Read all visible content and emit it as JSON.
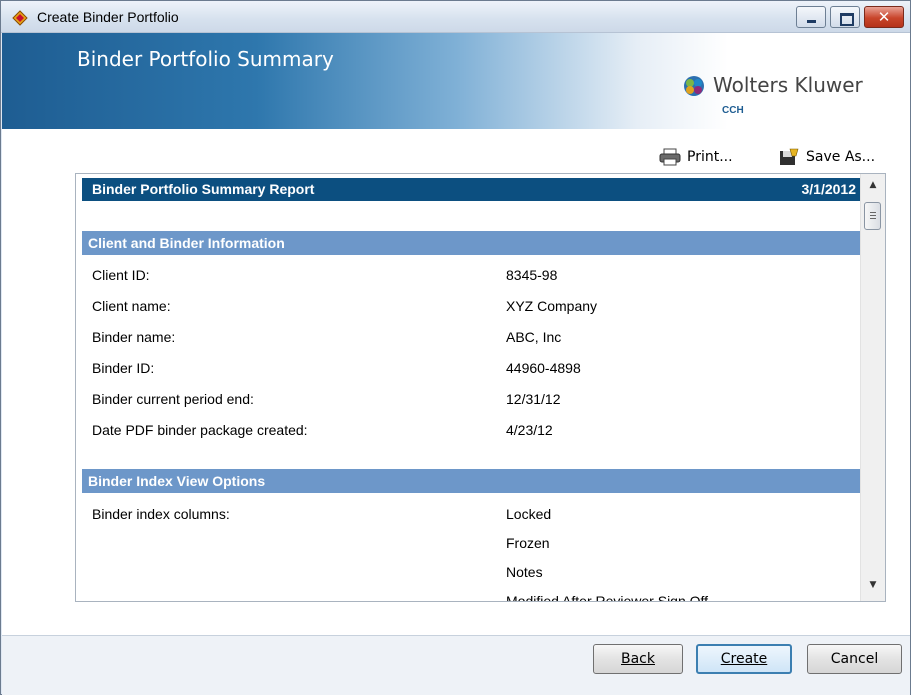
{
  "window": {
    "title": "Create Binder Portfolio"
  },
  "banner": {
    "title": "Binder Portfolio Summary",
    "logo_text": "Wolters Kluwer",
    "logo_sub": "CCH"
  },
  "toolbar": {
    "print_label": "Print...",
    "save_as_label": "Save As..."
  },
  "report": {
    "title": "Binder Portfolio  Summary Report",
    "date": "3/1/2012",
    "sections": [
      {
        "title": "Client and Binder Information",
        "rows": [
          {
            "label": "Client ID:",
            "value": "8345-98"
          },
          {
            "label": "Client name:",
            "value": "XYZ Company"
          },
          {
            "label": "Binder name:",
            "value": "ABC, Inc"
          },
          {
            "label": "Binder ID:",
            "value": "44960-4898"
          },
          {
            "label": "Binder current period end:",
            "value": "12/31/12"
          },
          {
            "label": "Date PDF binder package created:",
            "value": "4/23/12"
          }
        ]
      },
      {
        "title": "Binder Index View Options",
        "rows": [
          {
            "label": "Binder index columns:",
            "value": "Locked"
          },
          {
            "label": "",
            "value": "Frozen"
          },
          {
            "label": "",
            "value": "Notes"
          },
          {
            "label": "",
            "value": "Modified After Reviewer Sign Off"
          }
        ]
      }
    ]
  },
  "footer": {
    "back_label": "Back",
    "create_label": "Create",
    "cancel_label": "Cancel"
  },
  "colors": {
    "report_header": "#0c4f80",
    "section_header": "#6d97c9",
    "banner_dark": "#1e5d92"
  }
}
